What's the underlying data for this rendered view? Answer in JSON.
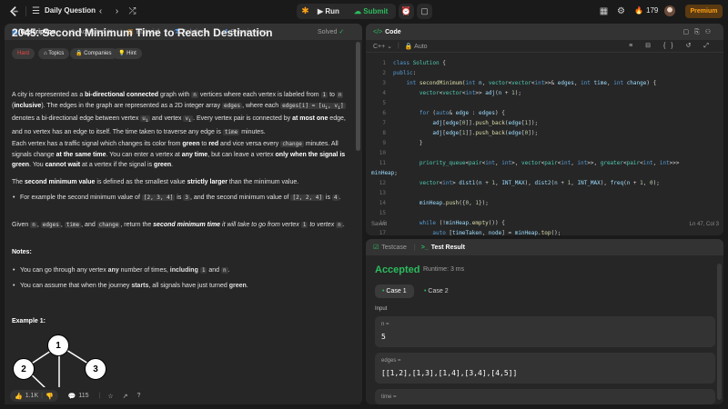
{
  "topbar": {
    "title": "Daily Question",
    "run_label": "Run",
    "submit_label": "Submit",
    "streak": "179",
    "premium_label": "Premium",
    "accent": "#ffa116",
    "success": "#2cbb5d"
  },
  "left_tabs": [
    {
      "label": "Description",
      "icon": "doc-icon"
    },
    {
      "label": "Accepted",
      "icon": "clock-icon"
    },
    {
      "label": "Editorial",
      "icon": "book-icon"
    },
    {
      "label": "Solutions",
      "icon": "flask-icon"
    },
    {
      "label": "Submissions",
      "icon": "history-icon"
    }
  ],
  "problem": {
    "title": "2045. Second Minimum Time to Reach Destination",
    "status": "Solved",
    "difficulty": "Hard",
    "tags_label": "Topics",
    "companies_label": "Companies",
    "hint_label": "Hint",
    "notes_heading": "Notes:",
    "example_heading": "Example 1:",
    "likes": "1.1K",
    "comments": "115"
  },
  "graph_nodes": [
    "1",
    "2",
    "3"
  ],
  "code_panel": {
    "title": "Code",
    "language": "C++",
    "mode": "Auto",
    "status": "Saved",
    "cursor": "Ln 47, Col 3"
  },
  "test_panel": {
    "tab_testcase": "Testcase",
    "tab_result": "Test Result",
    "verdict": "Accepted",
    "runtime": "Runtime: 3 ms",
    "case1": "Case 1",
    "case2": "Case 2",
    "input_label": "Input",
    "n_key": "n =",
    "n_val": "5",
    "edges_key": "edges =",
    "edges_val": "[[1,2],[1,3],[1,4],[3,4],[4,5]]",
    "time_key": "time ="
  }
}
